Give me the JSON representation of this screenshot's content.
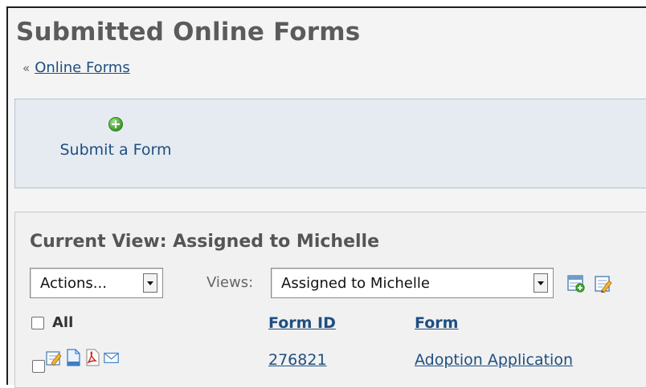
{
  "header": {
    "title": "Submitted Online Forms",
    "breadcrumb_prefix": "«",
    "breadcrumb_link": "Online Forms"
  },
  "actions_panel": {
    "submit_label": "Submit a Form",
    "submit_icon": "plus-circle-icon"
  },
  "view": {
    "title": "Current View: Assigned to Michelle",
    "actions_select": {
      "value": "Actions..."
    },
    "views_label": "Views:",
    "views_select": {
      "value": "Assigned to Michelle"
    },
    "tool_icons": [
      "add-view-icon",
      "edit-view-icon"
    ]
  },
  "table": {
    "select_all_label": "All",
    "columns": [
      "Form ID",
      "Form"
    ],
    "rows": [
      {
        "icons": [
          "edit-icon",
          "document-icon",
          "pdf-icon",
          "email-icon"
        ],
        "form_id": "276821",
        "form": "Adoption Application"
      }
    ]
  },
  "colors": {
    "link": "#1f4f80",
    "panel_blue": "#e6ebf1",
    "title_gray": "#5b5b5b"
  }
}
